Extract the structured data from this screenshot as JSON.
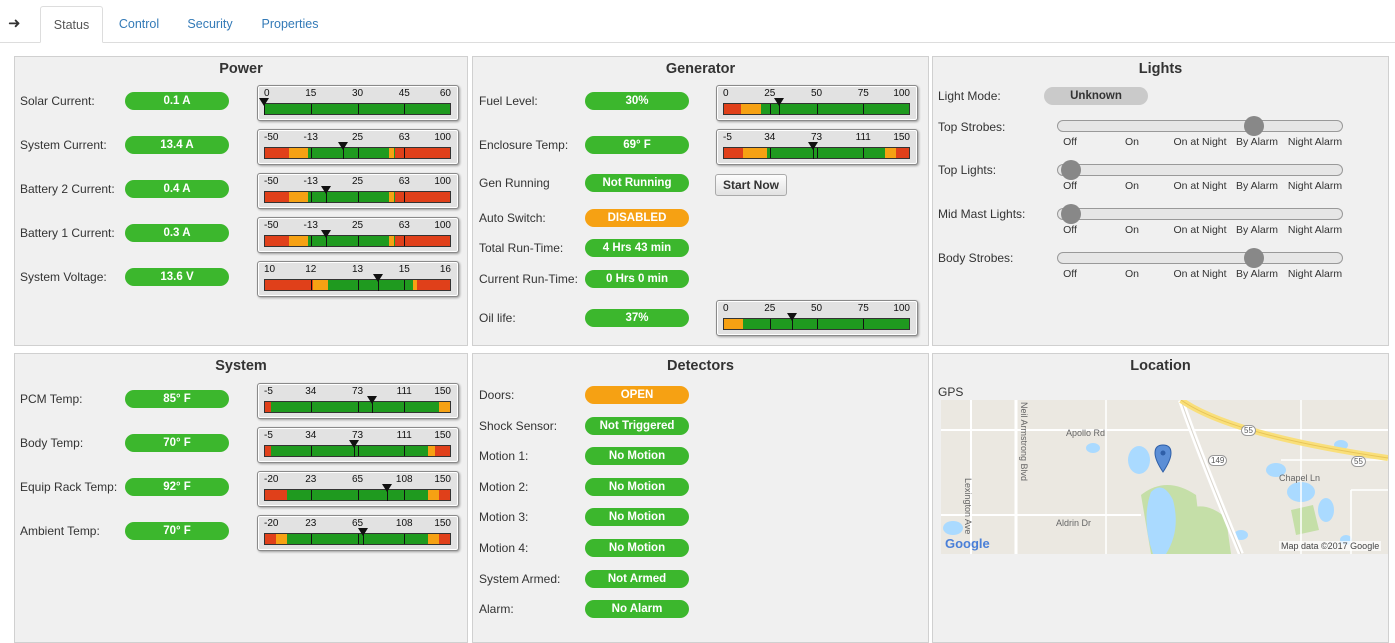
{
  "tabs": {
    "arrow": "➜",
    "items": [
      "Status",
      "Control",
      "Security",
      "Properties"
    ]
  },
  "power": {
    "title": "Power",
    "rows": [
      {
        "label": "Solar Current:",
        "value": "0.1 A",
        "ticks": [
          "0",
          "15",
          "30",
          "45",
          "60"
        ]
      },
      {
        "label": "System Current:",
        "value": "13.4 A",
        "ticks": [
          "-50",
          "-13",
          "25",
          "63",
          "100"
        ]
      },
      {
        "label": "Battery 2 Current:",
        "value": "0.4 A",
        "ticks": [
          "-50",
          "-13",
          "25",
          "63",
          "100"
        ]
      },
      {
        "label": "Battery 1 Current:",
        "value": "0.3 A",
        "ticks": [
          "-50",
          "-13",
          "25",
          "63",
          "100"
        ]
      },
      {
        "label": "System Voltage:",
        "value": "13.6 V",
        "ticks": [
          "10",
          "12",
          "13",
          "15",
          "16"
        ]
      }
    ]
  },
  "generator": {
    "title": "Generator",
    "fuel_label": "Fuel Level:",
    "fuel_value": "30%",
    "fuel_ticks": [
      "0",
      "25",
      "50",
      "75",
      "100"
    ],
    "temp_label": "Enclosure Temp:",
    "temp_value": "69° F",
    "temp_ticks": [
      "-5",
      "34",
      "73",
      "111",
      "150"
    ],
    "running_label": "Gen Running",
    "running_value": "Not Running",
    "start_button": "Start Now",
    "switch_label": "Auto Switch:",
    "switch_value": "DISABLED",
    "total_label": "Total Run-Time:",
    "total_value": "4 Hrs 43 min",
    "current_label": "Current Run-Time:",
    "current_value": "0 Hrs 0 min",
    "oil_label": "Oil life:",
    "oil_value": "37%",
    "oil_ticks": [
      "0",
      "25",
      "50",
      "75",
      "100"
    ]
  },
  "lights": {
    "title": "Lights",
    "mode_label": "Light Mode:",
    "mode_value": "Unknown",
    "options": [
      "Off",
      "On",
      "On at Night",
      "By Alarm",
      "Night Alarm"
    ],
    "sliders": [
      {
        "label": "Top Strobes:",
        "selected": "By Alarm"
      },
      {
        "label": "Top Lights:",
        "selected": "Off"
      },
      {
        "label": "Mid Mast Lights:",
        "selected": "Off"
      },
      {
        "label": "Body Strobes:",
        "selected": "By Alarm"
      }
    ]
  },
  "system": {
    "title": "System",
    "rows": [
      {
        "label": "PCM Temp:",
        "value": "85° F",
        "ticks": [
          "-5",
          "34",
          "73",
          "111",
          "150"
        ]
      },
      {
        "label": "Body Temp:",
        "value": "70° F",
        "ticks": [
          "-5",
          "34",
          "73",
          "111",
          "150"
        ]
      },
      {
        "label": "Equip Rack Temp:",
        "value": "92° F",
        "ticks": [
          "-20",
          "23",
          "65",
          "108",
          "150"
        ]
      },
      {
        "label": "Ambient Temp:",
        "value": "70° F",
        "ticks": [
          "-20",
          "23",
          "65",
          "108",
          "150"
        ]
      }
    ]
  },
  "detectors": {
    "title": "Detectors",
    "rows": [
      {
        "label": "Doors:",
        "value": "OPEN",
        "color": "orange"
      },
      {
        "label": "Shock Sensor:",
        "value": "Not Triggered",
        "color": "green"
      },
      {
        "label": "Motion 1:",
        "value": "No Motion",
        "color": "green"
      },
      {
        "label": "Motion 2:",
        "value": "No Motion",
        "color": "green"
      },
      {
        "label": "Motion 3:",
        "value": "No Motion",
        "color": "green"
      },
      {
        "label": "Motion 4:",
        "value": "No Motion",
        "color": "green"
      },
      {
        "label": "System Armed:",
        "value": "Not Armed",
        "color": "green"
      },
      {
        "label": "Alarm:",
        "value": "No Alarm",
        "color": "green"
      }
    ]
  },
  "location": {
    "title": "Location",
    "gps_label": "GPS",
    "map": {
      "roads": [
        "Apollo Rd",
        "Neil Armstrong Blvd",
        "Lexington Ave",
        "Aldrin Dr",
        "Chapel Ln"
      ],
      "shields": [
        "55",
        "149",
        "55"
      ],
      "brand": "Google",
      "attribution": "Map data ©2017 Google"
    }
  },
  "colors": {
    "green": "#3cb72d",
    "orange": "#f6a113",
    "gauge_green": "#1f9a1f",
    "gauge_orange": "#f6a113",
    "gauge_red": "#e0401a",
    "pill_grey": "#cacaca"
  }
}
